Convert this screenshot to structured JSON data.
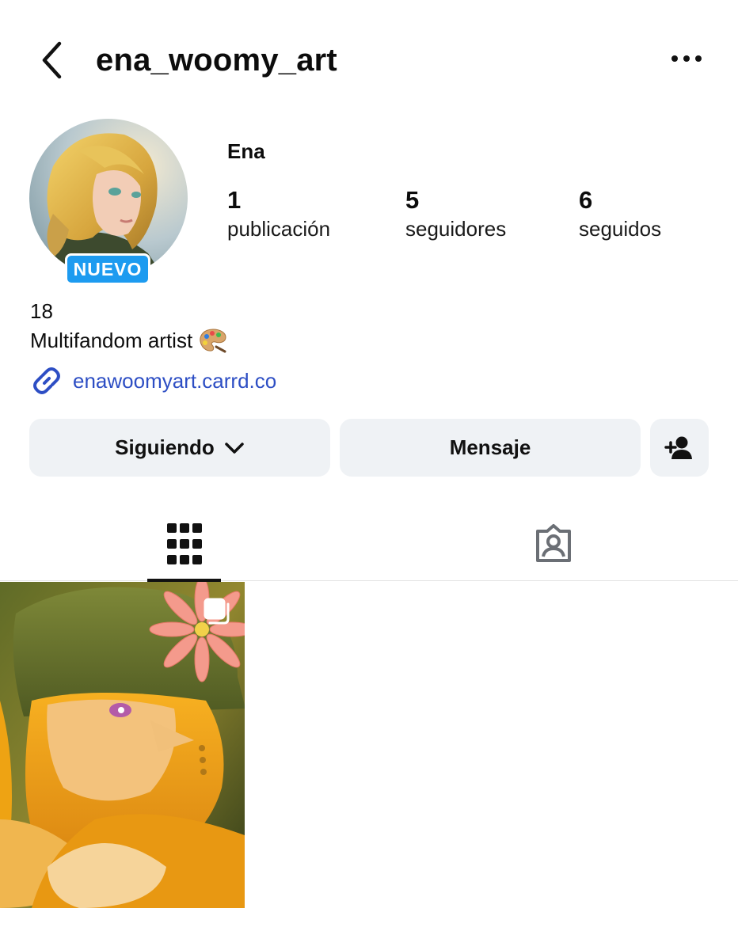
{
  "header": {
    "username": "ena_woomy_art",
    "back_icon": "chevron-left-icon",
    "more_icon": "more-horizontal-icon"
  },
  "profile": {
    "badge": "NUEVO",
    "display_name": "Ena",
    "stats": [
      {
        "value": "1",
        "label": "publicación"
      },
      {
        "value": "5",
        "label": "seguidores"
      },
      {
        "value": "6",
        "label": "seguidos"
      }
    ],
    "bio": [
      "18",
      "Multifandom artist"
    ],
    "bio_emoji": "palette-emoji",
    "link": "enawoomyart.carrd.co"
  },
  "actions": {
    "following": "Siguiendo",
    "message": "Mensaje",
    "suggest_icon": "add-person-icon"
  },
  "tabs": {
    "active": "posts-grid",
    "items": [
      "grid-icon",
      "tagged-icon"
    ]
  },
  "colors": {
    "badge": "#1d9bf0",
    "link": "#2d4ec4",
    "button_bg": "#eff2f5"
  }
}
